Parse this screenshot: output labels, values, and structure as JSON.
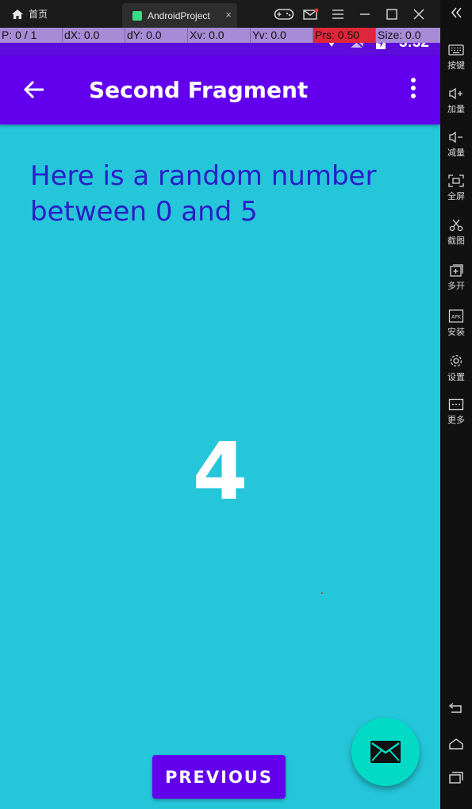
{
  "titlebar": {
    "home_tab": "首页",
    "app_tab": "AndroidProject",
    "close_tab": "×"
  },
  "sidebar": {
    "items": [
      {
        "label": "按键",
        "icon": "keyboard-icon"
      },
      {
        "label": "加量",
        "icon": "volume-up-icon"
      },
      {
        "label": "减量",
        "icon": "volume-down-icon"
      },
      {
        "label": "全屏",
        "icon": "fullscreen-icon"
      },
      {
        "label": "截图",
        "icon": "scissors-icon"
      },
      {
        "label": "多开",
        "icon": "multi-instance-icon"
      },
      {
        "label": "安装",
        "icon": "apk-icon"
      },
      {
        "label": "设置",
        "icon": "gear-icon"
      },
      {
        "label": "更多",
        "icon": "more-icon"
      }
    ]
  },
  "pointer_overlay": {
    "p": "P: 0 / 1",
    "dx": "dX: 0.0",
    "dy": "dY: 0.0",
    "xv": "Xv: 0.0",
    "yv": "Yv: 0.0",
    "prs": "Prs: 0.50",
    "size": "Size: 0.0"
  },
  "status_bar": {
    "time": "3:32"
  },
  "app_bar": {
    "title": "Second Fragment"
  },
  "content": {
    "headline": "Here is a random number between 0 and 5",
    "random_number": "4",
    "previous_button": "PREVIOUS"
  },
  "colors": {
    "primary": "#6200ee",
    "background": "#25c6da",
    "accent": "#03dac5",
    "headline_text": "#2a1ec8"
  }
}
